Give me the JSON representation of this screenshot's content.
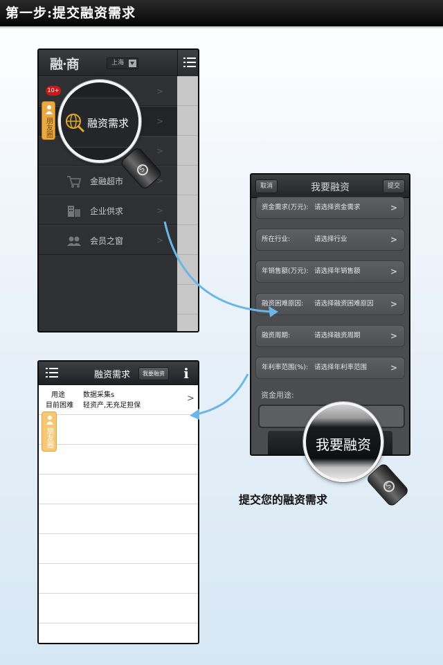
{
  "header": {
    "title": "第一步:提交融资需求"
  },
  "phone_menu": {
    "logo": "融·商",
    "city": "上海",
    "badge": "10+",
    "friends_tab": "朋友圈",
    "items": [
      {
        "label": "金融超市",
        "icon": "cart-icon"
      },
      {
        "label": "企业供求",
        "icon": "building-icon"
      },
      {
        "label": "会员之窗",
        "icon": "members-icon"
      }
    ],
    "magnified_label": "融资需求",
    "magnified_icon": "globe-search-icon"
  },
  "phone_form": {
    "cancel": "取消",
    "title": "我要融资",
    "submit_top": "提交",
    "fields": [
      {
        "key": "资金需求(万元):",
        "value": "请选择资金需求"
      },
      {
        "key": "所在行业:",
        "value": "请选择行业"
      },
      {
        "key": "年销售额(万元):",
        "value": "请选择年销售额"
      },
      {
        "key": "融资困难原因:",
        "value": "请选择融资困难原因"
      },
      {
        "key": "融资周期:",
        "value": "请选择融资周期"
      },
      {
        "key": "年利率范围(%):",
        "value": "请选择年利率范围"
      }
    ],
    "use_label": "资金用途:",
    "magnified_submit": "我要融资",
    "caption": "提交您的融资需求"
  },
  "phone_list": {
    "title": "融资需求",
    "action": "我要融资",
    "info": "i",
    "friends_tab": "朋友圈",
    "entry": {
      "use_label": "用途",
      "use_value": "数据采集s",
      "difficulty_label": "目前困难",
      "difficulty_value": "轻资产,无充足担保"
    }
  }
}
